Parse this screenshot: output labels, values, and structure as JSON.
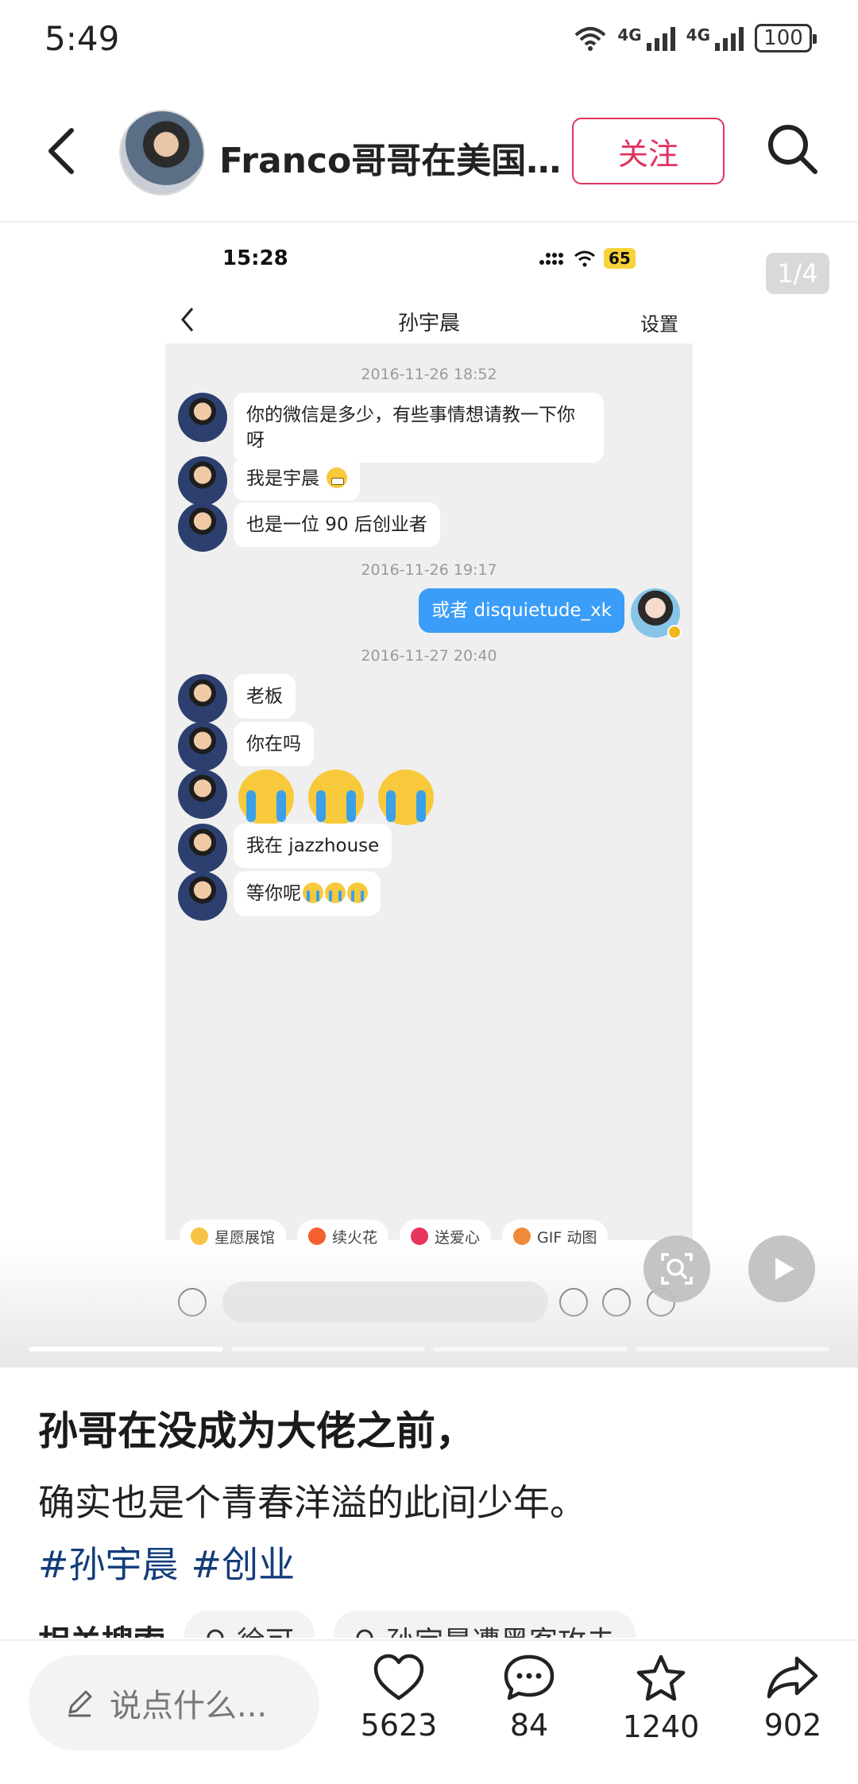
{
  "status_bar": {
    "time": "5:49",
    "network1": "4G",
    "network2": "4G",
    "battery": "100"
  },
  "header": {
    "author_name": "Franco哥哥在美国（...",
    "follow_label": "关注"
  },
  "carousel": {
    "page_counter": "1/4",
    "screenshot": {
      "time": "15:28",
      "battery": "65",
      "title": "孙宇晨",
      "settings_label": "设置",
      "timestamps": [
        "2016-11-26 18:52",
        "2016-11-26 19:17",
        "2016-11-27 20:40"
      ],
      "messages": [
        {
          "text": "你的微信是多少，有些事情想请教一下你呀"
        },
        {
          "text": "我是宇晨"
        },
        {
          "text": "也是一位 90 后创业者"
        },
        {
          "text": "或者 disquietude_xk"
        },
        {
          "text": "老板"
        },
        {
          "text": "你在吗"
        },
        {
          "text": "我在 jazzhouse"
        },
        {
          "text": "等你呢"
        }
      ],
      "quick_chips": [
        "星愿展馆",
        "续火花",
        "送爱心",
        "GIF 动图"
      ]
    }
  },
  "post": {
    "title": "孙哥在没成为大佬之前，",
    "body": "确实也是个青春洋溢的此间少年。",
    "tags": [
      "#孙宇晨",
      "#创业"
    ],
    "related_label": "相关搜索",
    "related_chips": [
      "徐可",
      "孙宇晨遭黑客攻击"
    ]
  },
  "bottom_bar": {
    "input_placeholder": "说点什么...",
    "likes": "5623",
    "comments": "84",
    "favorites": "1240",
    "shares": "902"
  }
}
